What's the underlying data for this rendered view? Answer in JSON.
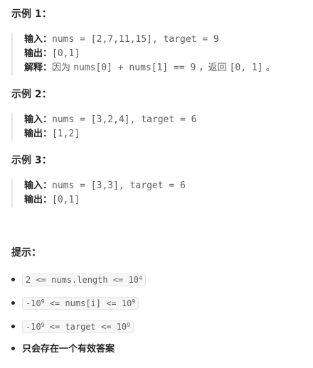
{
  "examples": [
    {
      "heading": "示例 1：",
      "input_label": "输入：",
      "input_value": "nums = [2,7,11,15], target = 9",
      "output_label": "输出：",
      "output_value": "[0,1]",
      "explain_label": "解释：",
      "explain_prefix": "因为 ",
      "explain_code": "nums[0] + nums[1] == 9",
      "explain_mid": " ，返回 ",
      "explain_result": "[0, 1]",
      "explain_suffix": " 。"
    },
    {
      "heading": "示例 2：",
      "input_label": "输入：",
      "input_value": "nums = [3,2,4], target = 6",
      "output_label": "输出：",
      "output_value": "[1,2]"
    },
    {
      "heading": "示例 3：",
      "input_label": "输入：",
      "input_value": "nums = [3,3], target = 6",
      "output_label": "输出：",
      "output_value": "[0,1]"
    }
  ],
  "hints": {
    "heading": "提示：",
    "items": [
      {
        "pre": "2 <= nums.length <= 10",
        "sup": "4"
      },
      {
        "pre": "-10",
        "sup1": "9",
        "mid": " <= nums[i] <= 10",
        "sup2": "9"
      },
      {
        "pre": "-10",
        "sup1": "9",
        "mid": " <= target <= 10",
        "sup2": "9"
      },
      {
        "text": "只会存在一个有效答案"
      }
    ]
  }
}
